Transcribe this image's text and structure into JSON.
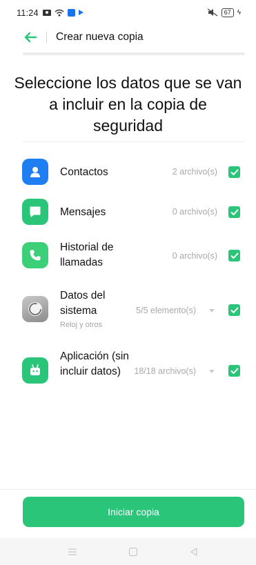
{
  "status_bar": {
    "time": "11:24",
    "battery": "67",
    "bolt": "ϟ",
    "icons": [
      "photo-icon",
      "wifi-icon",
      "bluetooth-icon",
      "play-icon",
      "mute-icon",
      "battery-icon",
      "charging-icon"
    ]
  },
  "header": {
    "title": "Crear nueva copia",
    "back_icon": "arrow-left-icon"
  },
  "heading": "Seleccione los datos que se van a incluir en la copia de seguridad",
  "items": [
    {
      "title": "Contactos",
      "subtitle": "",
      "count": "2 archivo(s)",
      "checked": true,
      "has_dropdown": false,
      "icon": "contacts-icon",
      "icon_color": "#1f7ef2"
    },
    {
      "title": "Mensajes",
      "subtitle": "",
      "count": "0 archivo(s)",
      "checked": true,
      "has_dropdown": false,
      "icon": "message-icon",
      "icon_color": "#2bc57a"
    },
    {
      "title": "Historial de llamadas",
      "subtitle": "",
      "count": "0 archivo(s)",
      "checked": true,
      "has_dropdown": false,
      "icon": "phone-icon",
      "icon_color": "#3ccf78"
    },
    {
      "title": "Datos del sistema",
      "subtitle": "Reloj y otros",
      "count": "5/5 elemento(s)",
      "checked": true,
      "has_dropdown": true,
      "icon": "system-icon",
      "icon_color": "#9a9a9a"
    },
    {
      "title": "Aplicación (sin incluir datos)",
      "subtitle": "",
      "count": "18/18 archivo(s)",
      "checked": true,
      "has_dropdown": true,
      "icon": "android-icon",
      "icon_color": "#2bc57a"
    }
  ],
  "start_button": "Iniciar copia",
  "nav": {
    "icons": [
      "menu-icon",
      "home-icon",
      "back-triangle-icon"
    ]
  },
  "colors": {
    "accent": "#2bc57a",
    "check": "#2bc57a",
    "muted_text": "#a9a9a9"
  }
}
